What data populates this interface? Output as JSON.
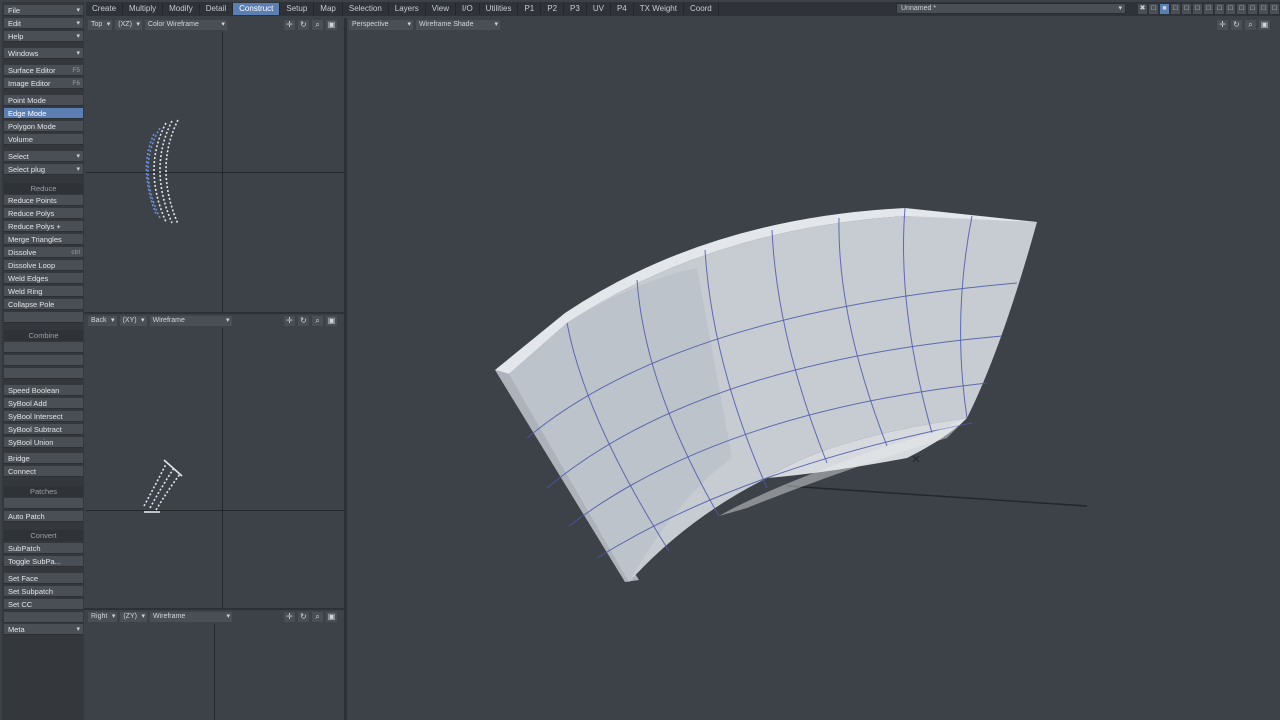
{
  "topbar": {
    "tabs": [
      "Create",
      "Multiply",
      "Modify",
      "Detail",
      "Construct",
      "Setup",
      "Map",
      "Selection",
      "Layers",
      "View",
      "I/O",
      "Utilities",
      "P1",
      "P2",
      "P3",
      "UV",
      "P4",
      "TX Weight",
      "Coord"
    ],
    "active_tab": "Construct",
    "scene": "Unnamed *"
  },
  "sidebar": {
    "file": "File",
    "edit": "Edit",
    "help": "Help",
    "windows": "Windows",
    "surface_editor": "Surface Editor",
    "surface_editor_sc": "F5",
    "image_editor": "Image Editor",
    "image_editor_sc": "F6",
    "point_mode": "Point Mode",
    "edge_mode": "Edge Mode",
    "polygon_mode": "Polygon Mode",
    "volume": "Volume",
    "select": "Select",
    "select_plug": "Select plug",
    "reduce_header": "Reduce",
    "reduce_points": "Reduce Points",
    "reduce_polys": "Reduce Polys",
    "reduce_polys_plus": "Reduce Polys +",
    "merge_triangles": "Merge Triangles",
    "dissolve": "Dissolve",
    "dissolve_sc": "ctrl",
    "dissolve_loop": "Dissolve Loop",
    "weld_edges": "Weld Edges",
    "weld_ring": "Weld Ring",
    "collapse_pole": "Collapse Pole",
    "combine_header": "Combine",
    "speed_boolean": "Speed Boolean",
    "sybool_add": "SyBool Add",
    "sybool_intersect": "SyBool Intersect",
    "sybool_subtract": "SyBool Subtract",
    "sybool_union": "SyBool Union",
    "bridge": "Bridge",
    "connect": "Connect",
    "patches_header": "Patches",
    "auto_patch": "Auto Patch",
    "convert_header": "Convert",
    "subpatch": "SubPatch",
    "toggle_subpatch": "Toggle SubPa...",
    "set_face": "Set Face",
    "set_subpatch": "Set Subpatch",
    "set_cc": "Set CC",
    "meta": "Meta"
  },
  "viewports": {
    "top": {
      "view": "Top",
      "axis": "(XZ)",
      "shade": "Color Wireframe"
    },
    "back": {
      "view": "Back",
      "axis": "(XY)",
      "shade": "Wireframe"
    },
    "right": {
      "view": "Right",
      "axis": "(ZY)",
      "shade": "Wireframe"
    },
    "main": {
      "view": "Perspective",
      "shade": "Wireframe Shade"
    }
  },
  "colors": {
    "accent": "#5b7fb3",
    "background": "#3d4148",
    "mesh": "#c9ced6",
    "mesh_edge": "#4a5aa8"
  }
}
